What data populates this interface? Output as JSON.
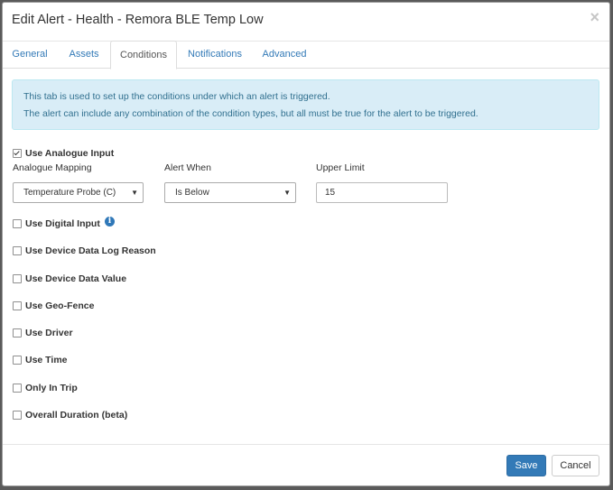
{
  "modal": {
    "title": "Edit Alert - Health - Remora BLE Temp Low",
    "close_glyph": "×"
  },
  "tabs": [
    {
      "label": "General",
      "active": false
    },
    {
      "label": "Assets",
      "active": false
    },
    {
      "label": "Conditions",
      "active": true
    },
    {
      "label": "Notifications",
      "active": false
    },
    {
      "label": "Advanced",
      "active": false
    }
  ],
  "info": {
    "line1": "This tab is used to set up the conditions under which an alert is triggered.",
    "line2": "The alert can include any combination of the condition types, but all must be true for the alert to be triggered."
  },
  "analogue": {
    "label": "Use Analogue Input",
    "checked": true,
    "mapping_label": "Analogue Mapping",
    "mapping_value": "Temperature Probe (C)",
    "alert_when_label": "Alert When",
    "alert_when_value": "Is Below",
    "upper_limit_label": "Upper Limit",
    "upper_limit_value": "15"
  },
  "conditions": [
    {
      "label": "Use Digital Input",
      "checked": false
    },
    {
      "label": "Use Device Data Log Reason",
      "checked": false
    },
    {
      "label": "Use Device Data Value",
      "checked": false
    },
    {
      "label": "Use Geo-Fence",
      "checked": false
    },
    {
      "label": "Use Driver",
      "checked": false
    },
    {
      "label": "Use Time",
      "checked": false
    },
    {
      "label": "Only In Trip",
      "checked": false
    },
    {
      "label": "Overall Duration (beta)",
      "checked": false
    }
  ],
  "icons": {
    "info_glyph": "i",
    "dropdown_glyph": "▼"
  },
  "footer": {
    "save_label": "Save",
    "cancel_label": "Cancel"
  },
  "colors": {
    "primary": "#337ab7",
    "info_bg": "#d9edf7",
    "info_text": "#31708f"
  }
}
